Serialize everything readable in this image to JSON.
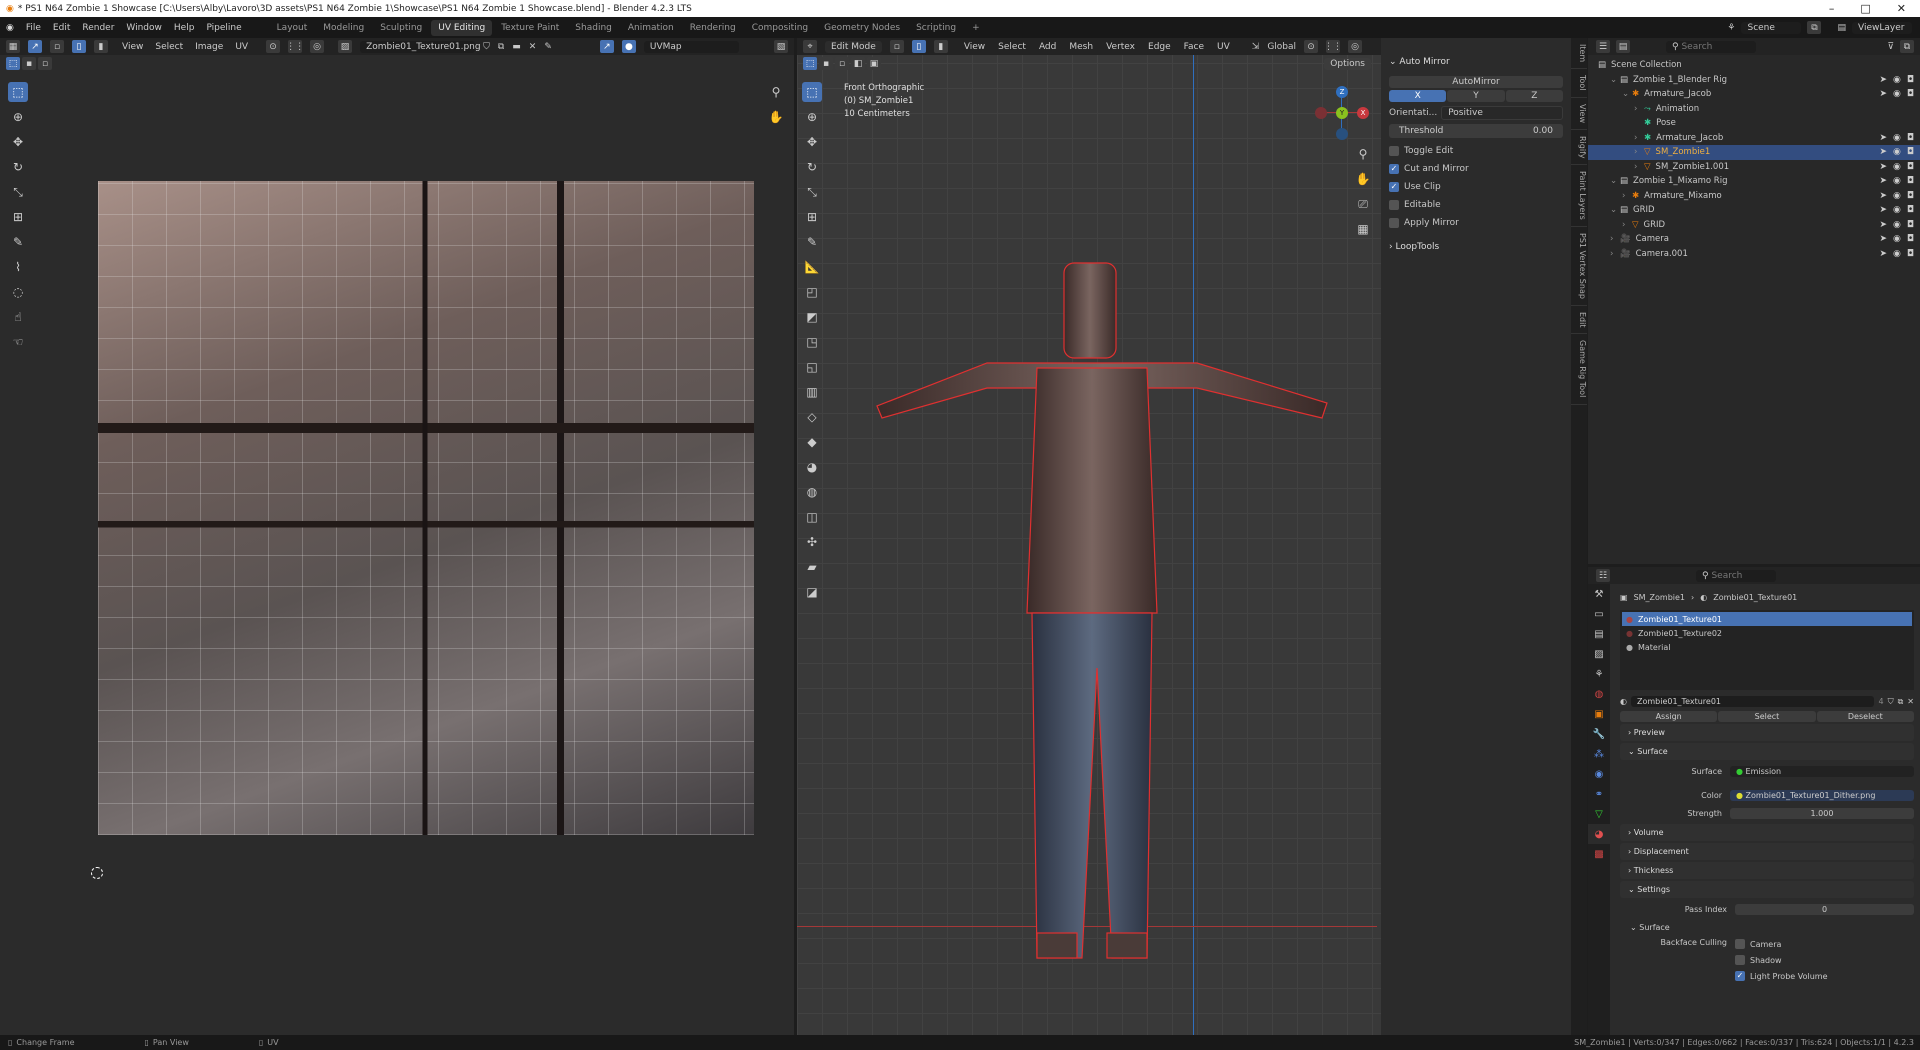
{
  "window": {
    "title": "* PS1 N64 Zombie 1 Showcase [C:\\Users\\Alby\\Lavoro\\3D assets\\PS1 N64 Zombie 1\\Showcase\\PS1 N64 Zombie 1 Showcase.blend] - Blender 4.2.3 LTS",
    "minimize": "–",
    "maximize": "□",
    "close": "✕"
  },
  "menus": [
    "File",
    "Edit",
    "Render",
    "Window",
    "Help",
    "Pipeline"
  ],
  "workspaces": [
    "Layout",
    "Modeling",
    "Sculpting",
    "UV Editing",
    "Texture Paint",
    "Shading",
    "Animation",
    "Rendering",
    "Compositing",
    "Geometry Nodes",
    "Scripting",
    "+"
  ],
  "active_workspace": "UV Editing",
  "scene": {
    "label": "Scene",
    "viewlayer": "ViewLayer"
  },
  "uv_editor": {
    "menus": [
      "View",
      "Select",
      "Image",
      "UV"
    ],
    "image_name": "Zombie01_Texture01.png",
    "uvmap": "UVMap"
  },
  "viewport": {
    "mode": "Edit Mode",
    "menus": [
      "View",
      "Select",
      "Add",
      "Mesh",
      "Vertex",
      "Edge",
      "Face",
      "UV"
    ],
    "orientation": "Global",
    "options": "Options",
    "overlay": {
      "view_name": "Front Orthographic",
      "object": "(0) SM_Zombie1",
      "scale": "10 Centimeters"
    },
    "gizmo": {
      "x": "X",
      "y": "Y",
      "z": "Z"
    }
  },
  "npanel": {
    "auto_mirror": {
      "title": "Auto Mirror",
      "button": "AutoMirror",
      "axes": [
        "X",
        "Y",
        "Z"
      ],
      "orientation_label": "Orientati...",
      "orientation_value": "Positive",
      "threshold_label": "Threshold",
      "threshold_value": "0.00",
      "options": [
        {
          "label": "Toggle Edit",
          "checked": false
        },
        {
          "label": "Cut and Mirror",
          "checked": true
        },
        {
          "label": "Use Clip",
          "checked": true
        },
        {
          "label": "Editable",
          "checked": false
        },
        {
          "label": "Apply Mirror",
          "checked": false
        }
      ]
    },
    "looptools": "LoopTools",
    "tabs": [
      "Item",
      "Tool",
      "View",
      "Rigify",
      "Paint Layers",
      "PS1 Vertex Snap",
      "Edit",
      "Game Rig Tool"
    ]
  },
  "outliner": {
    "search_placeholder": "Search",
    "items": [
      {
        "label": "Scene Collection",
        "indent": 0
      },
      {
        "label": "Zombie 1_Blender Rig",
        "indent": 1
      },
      {
        "label": "Armature_Jacob",
        "indent": 2
      },
      {
        "label": "Animation",
        "indent": 3
      },
      {
        "label": "Pose",
        "indent": 3
      },
      {
        "label": "Armature_Jacob",
        "indent": 3
      },
      {
        "label": "SM_Zombie1",
        "indent": 3,
        "selected": true
      },
      {
        "label": "SM_Zombie1.001",
        "indent": 3
      },
      {
        "label": "Zombie 1_Mixamo Rig",
        "indent": 1
      },
      {
        "label": "Armature_Mixamo",
        "indent": 2
      },
      {
        "label": "GRID",
        "indent": 1
      },
      {
        "label": "GRID",
        "indent": 2
      },
      {
        "label": "Camera",
        "indent": 1
      },
      {
        "label": "Camera.001",
        "indent": 1
      }
    ]
  },
  "properties": {
    "search_placeholder": "Search",
    "breadcrumb": [
      "SM_Zombie1",
      "Zombie01_Texture01"
    ],
    "slots": [
      "Zombie01_Texture01",
      "Zombie01_Texture02",
      "Material"
    ],
    "material_name": "Zombie01_Texture01",
    "users": "4",
    "actions": [
      "Assign",
      "Select",
      "Deselect"
    ],
    "panels": {
      "preview": "Preview",
      "surface": "Surface",
      "volume": "Volume",
      "displacement": "Displacement",
      "thickness": "Thickness",
      "settings": "Settings"
    },
    "surface_label": "Surface",
    "surface_value": "Emission",
    "color_label": "Color",
    "color_value": "Zombie01_Texture01_Dither.png",
    "strength_label": "Strength",
    "strength_value": "1.000",
    "pass_index_label": "Pass Index",
    "pass_index_value": "0",
    "sub_surface": "Surface",
    "backface_label": "Backface Culling",
    "backface": [
      {
        "label": "Camera",
        "checked": false
      },
      {
        "label": "Shadow",
        "checked": false
      },
      {
        "label": "Light Probe Volume",
        "checked": true
      }
    ]
  },
  "status": {
    "hints": [
      "Change Frame",
      "Pan View",
      "UV"
    ],
    "stats": "SM_Zombie1 | Verts:0/347 | Edges:0/662 | Faces:0/337 | Tris:624 | Objects:1/1 | 4.2.3"
  }
}
